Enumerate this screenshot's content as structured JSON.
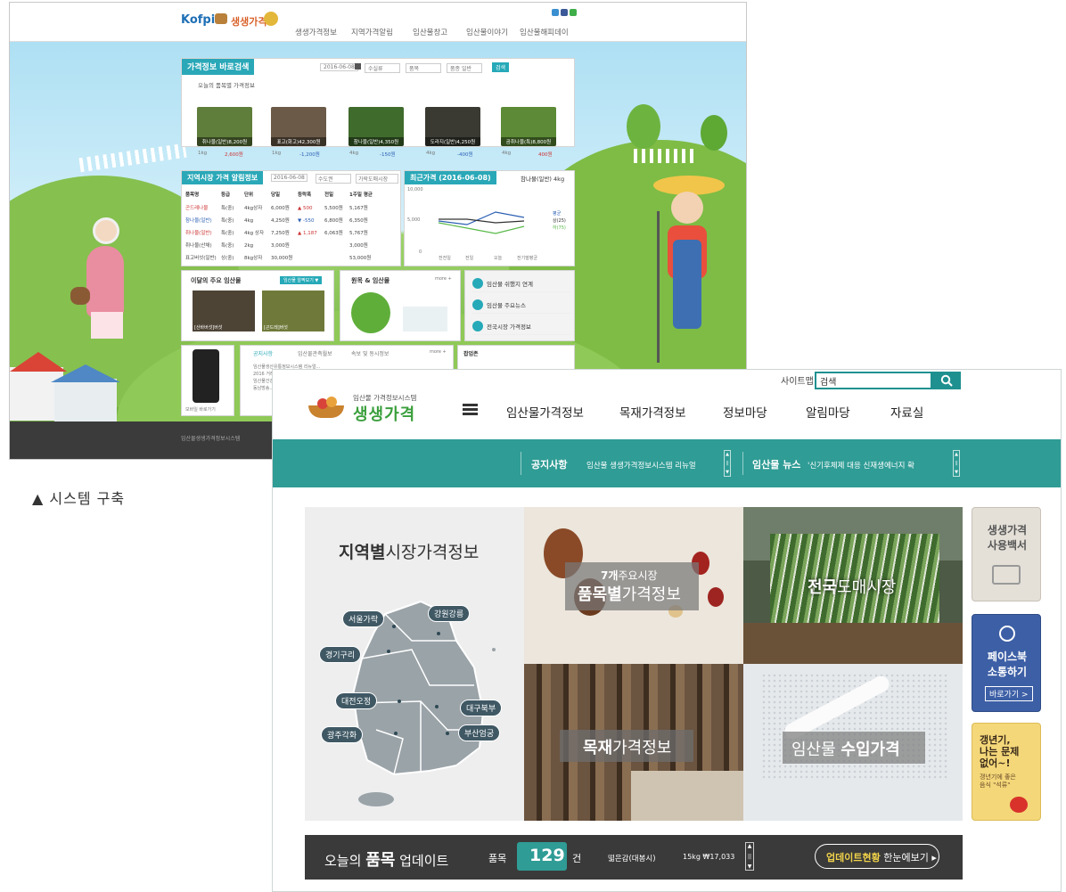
{
  "caption": "▲ 시스템 구축",
  "old_site": {
    "brand": "Kofpi",
    "brand_name": "생생가격",
    "menu": [
      "생생가격정보",
      "지역가격알림",
      "임산물창고",
      "임산물이야기",
      "임산물해피데이"
    ],
    "price_search": {
      "title": "가격정보 바로검색",
      "date": "2016-06-08",
      "select1": "수실류",
      "select2": "품목",
      "select3": "품종 일반",
      "button": "검색",
      "today_label": "오늘의 품목별 가격정보"
    },
    "products": [
      {
        "name": "취나물(일반)8,200원",
        "unit": "1kg",
        "change": "2,600원"
      },
      {
        "name": "표고(화고)42,300원",
        "unit": "1kg",
        "change": "-1,200원"
      },
      {
        "name": "참나물(일반)4,350원",
        "unit": "4kg",
        "change": "-150원"
      },
      {
        "name": "도라지(일반)4,250원",
        "unit": "4kg",
        "change": "-400원"
      },
      {
        "name": "곰취나물(특)8,800원",
        "unit": "4kg",
        "change": "400원"
      }
    ],
    "market_panel": {
      "title": "지역시장 가격 알림정보",
      "date": "2016-06-08",
      "sel1": "수도권",
      "sel2": "가락도매시장",
      "headers": [
        "품목명",
        "등급",
        "단위",
        "당일",
        "등락폭",
        "전일",
        "1주일 평균"
      ],
      "rows": [
        [
          "곤드레나물",
          "특(중)",
          "4kg상자",
          "6,000원",
          "▲ 500",
          "5,500원",
          "5,167원"
        ],
        [
          "참나물(일반)",
          "특(중)",
          "4kg",
          "4,250원",
          "▼ -550",
          "6,800원",
          "6,350원"
        ],
        [
          "취나물(일반)",
          "특(중)",
          "4kg 상자",
          "7,250원",
          "▲ 1,187",
          "6,063원",
          "5,767원"
        ],
        [
          "취나물(산채)",
          "특(중)",
          "2kg",
          "3,000원",
          "",
          "",
          "3,000원"
        ],
        [
          "표고버섯(일반)",
          "상(중)",
          "8kg상자",
          "30,000원",
          "",
          "",
          "53,000원"
        ]
      ]
    },
    "recent_price": {
      "title": "최근가격 (2016-06-08)",
      "product": "참나물(일반) 4kg",
      "y_ticks": [
        "10,000",
        "5,000",
        "0"
      ],
      "x_labels": [
        "전전일",
        "전일",
        "오늘",
        "전기말평균"
      ],
      "legend": [
        "평균",
        "상(25)",
        "하(75)"
      ]
    },
    "monthly": {
      "title": "이달의 주요 임산물",
      "button": "임산물 알짝보기 ▼",
      "captions": [
        "[산바버섯]버섯",
        "[곤드레]버섯"
      ]
    },
    "wood": {
      "title": "원목 & 임산물",
      "more": "more +"
    },
    "services": [
      "임산물 쉬했지 연계",
      "임산물 주요뉴스",
      "전국시장 가격정보"
    ],
    "tabs": [
      "공지사항",
      "임산물관측월보",
      "속보 및 동시정보",
      "more +"
    ],
    "notices": [
      "임산물생산유통정보시스템 리뉴얼...",
      "2016 거래...",
      "임산물건강...",
      "동남방송..."
    ],
    "app_label": "모바일 바로가기",
    "right_title": "팝업존",
    "footer": "임산물생생가격정보시스템"
  },
  "new_site": {
    "logo_small": "임산물 가격정보시스템",
    "logo_big": "생생가격",
    "nav": [
      "임산물가격정보",
      "목재가격정보",
      "정보마당",
      "알림마당",
      "자료실"
    ],
    "sitemap": "사이트맵",
    "search_value": "검색",
    "ticker": {
      "notice_label": "공지사항",
      "notice_text": "임산물 생생가격정보시스템 리뉴얼",
      "news_label": "임산물 뉴스",
      "news_text": "'신기후체제 대응 신재생에너지 확"
    },
    "region": {
      "title_bold": "지역별",
      "title_rest": "시장가격정보",
      "pins": [
        "서울가락",
        "강원강릉",
        "경기구리",
        "대전오정",
        "대구북부",
        "광주각화",
        "부산엄궁"
      ]
    },
    "tiles": {
      "product_line1_bold": "7개",
      "product_line1_rest": "주요시장",
      "product_line2_bold": "품목별",
      "product_line2_rest": "가격정보",
      "wholesale_bold": "전국",
      "wholesale_rest": "도매시장",
      "wood_bold": "목재",
      "wood_rest": "가격정보",
      "import_rest": "임산물",
      "import_bold": "수입가격"
    },
    "side": {
      "manual": [
        "생생가격",
        "사용백서"
      ],
      "facebook": [
        "페이스북",
        "소통하기"
      ],
      "facebook_btn": "바로가기 >",
      "ad": [
        "갱년기,",
        "나는 문제",
        "없어~!"
      ],
      "ad_sub": [
        "갱년기에 좋은",
        "음식 \"석류\""
      ]
    },
    "update": {
      "title_pre": "오늘의",
      "title_bold": "품목",
      "title_post": "업데이트",
      "count_label": "품목",
      "count": "129",
      "count_unit": "건",
      "item": "떫은감(대봉시)",
      "item_price": "15kg ₩17,033",
      "button_bold": "업데이트현황",
      "button_rest": "한눈에보기"
    }
  }
}
